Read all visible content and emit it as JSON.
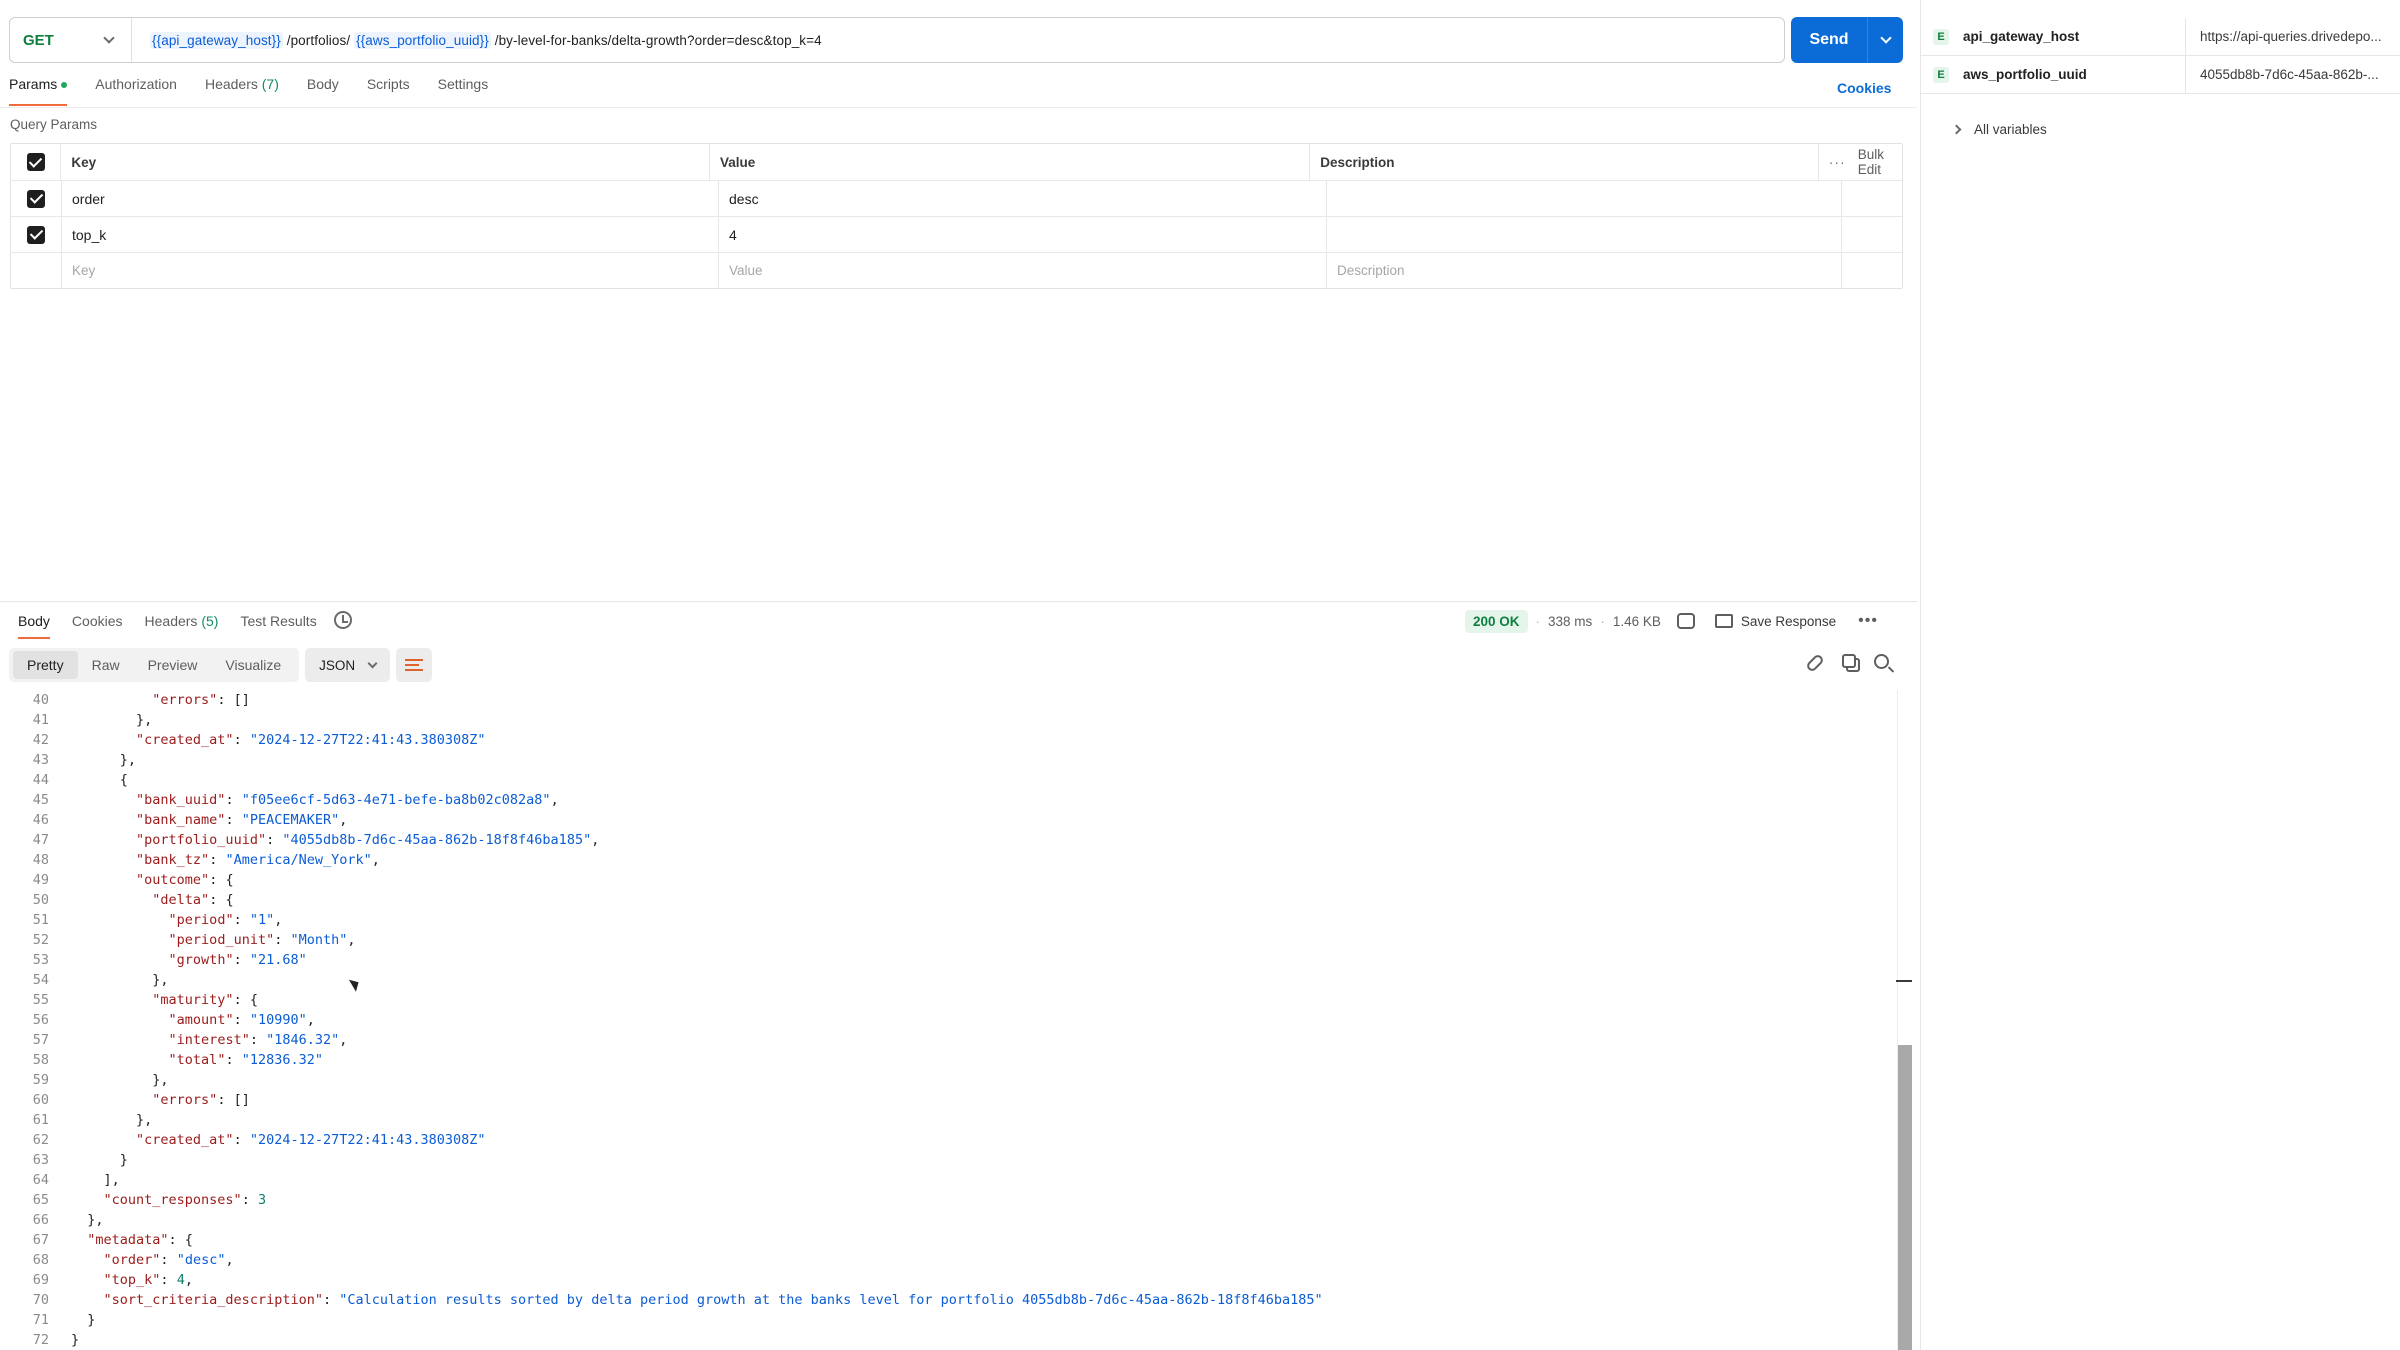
{
  "request": {
    "method": "GET",
    "url_parts": [
      {
        "text": "{{api_gateway_host}}",
        "var": true
      },
      {
        "text": " /portfolios/ ",
        "var": false
      },
      {
        "text": "{{aws_portfolio_uuid}}",
        "var": true
      },
      {
        "text": " /by-level-for-banks/delta-growth?order=desc&top_k=4",
        "var": false
      }
    ],
    "send_label": "Send",
    "tabs": [
      {
        "label": "Params",
        "dot": true,
        "active": true
      },
      {
        "label": "Authorization"
      },
      {
        "label": "Headers",
        "count": "(7)"
      },
      {
        "label": "Body"
      },
      {
        "label": "Scripts"
      },
      {
        "label": "Settings"
      }
    ],
    "cookies_label": "Cookies",
    "query_params_title": "Query Params",
    "table": {
      "headers": {
        "key": "Key",
        "value": "Value",
        "description": "Description",
        "bulk_edit": "Bulk Edit"
      },
      "rows": [
        {
          "key": "order",
          "value": "desc",
          "description": ""
        },
        {
          "key": "top_k",
          "value": "4",
          "description": ""
        }
      ],
      "placeholders": {
        "key": "Key",
        "value": "Value",
        "description": "Description"
      }
    }
  },
  "response": {
    "tabs": [
      {
        "label": "Body",
        "active": true
      },
      {
        "label": "Cookies"
      },
      {
        "label": "Headers",
        "count": "(5)"
      },
      {
        "label": "Test Results"
      }
    ],
    "status": "200 OK",
    "time": "338 ms",
    "size": "1.46 KB",
    "save_label": "Save Response",
    "modes": [
      "Pretty",
      "Raw",
      "Preview",
      "Visualize"
    ],
    "active_mode": "Pretty",
    "format": "JSON",
    "lines": [
      {
        "n": "40",
        "indent": 10,
        "tokens": [
          [
            "k",
            "\"errors\""
          ],
          [
            "p",
            ": []"
          ]
        ]
      },
      {
        "n": "41",
        "indent": 8,
        "tokens": [
          [
            "p",
            "},"
          ]
        ]
      },
      {
        "n": "42",
        "indent": 8,
        "tokens": [
          [
            "k",
            "\"created_at\""
          ],
          [
            "p",
            ": "
          ],
          [
            "s",
            "\"2024-12-27T22:41:43.380308Z\""
          ]
        ]
      },
      {
        "n": "43",
        "indent": 6,
        "tokens": [
          [
            "p",
            "},"
          ]
        ]
      },
      {
        "n": "44",
        "indent": 6,
        "tokens": [
          [
            "p",
            "{"
          ]
        ]
      },
      {
        "n": "45",
        "indent": 8,
        "tokens": [
          [
            "k",
            "\"bank_uuid\""
          ],
          [
            "p",
            ": "
          ],
          [
            "s",
            "\"f05ee6cf-5d63-4e71-befe-ba8b02c082a8\""
          ],
          [
            "p",
            ","
          ]
        ]
      },
      {
        "n": "46",
        "indent": 8,
        "tokens": [
          [
            "k",
            "\"bank_name\""
          ],
          [
            "p",
            ": "
          ],
          [
            "s",
            "\"PEACEMAKER\""
          ],
          [
            "p",
            ","
          ]
        ]
      },
      {
        "n": "47",
        "indent": 8,
        "tokens": [
          [
            "k",
            "\"portfolio_uuid\""
          ],
          [
            "p",
            ": "
          ],
          [
            "s",
            "\"4055db8b-7d6c-45aa-862b-18f8f46ba185\""
          ],
          [
            "p",
            ","
          ]
        ]
      },
      {
        "n": "48",
        "indent": 8,
        "tokens": [
          [
            "k",
            "\"bank_tz\""
          ],
          [
            "p",
            ": "
          ],
          [
            "s",
            "\"America/New_York\""
          ],
          [
            "p",
            ","
          ]
        ]
      },
      {
        "n": "49",
        "indent": 8,
        "tokens": [
          [
            "k",
            "\"outcome\""
          ],
          [
            "p",
            ": {"
          ]
        ]
      },
      {
        "n": "50",
        "indent": 10,
        "tokens": [
          [
            "k",
            "\"delta\""
          ],
          [
            "p",
            ": {"
          ]
        ]
      },
      {
        "n": "51",
        "indent": 12,
        "tokens": [
          [
            "k",
            "\"period\""
          ],
          [
            "p",
            ": "
          ],
          [
            "s",
            "\"1\""
          ],
          [
            "p",
            ","
          ]
        ]
      },
      {
        "n": "52",
        "indent": 12,
        "tokens": [
          [
            "k",
            "\"period_unit\""
          ],
          [
            "p",
            ": "
          ],
          [
            "s",
            "\"Month\""
          ],
          [
            "p",
            ","
          ]
        ]
      },
      {
        "n": "53",
        "indent": 12,
        "tokens": [
          [
            "k",
            "\"growth\""
          ],
          [
            "p",
            ": "
          ],
          [
            "s",
            "\"21.68\""
          ]
        ]
      },
      {
        "n": "54",
        "indent": 10,
        "tokens": [
          [
            "p",
            "},"
          ]
        ]
      },
      {
        "n": "55",
        "indent": 10,
        "tokens": [
          [
            "k",
            "\"maturity\""
          ],
          [
            "p",
            ": {"
          ]
        ]
      },
      {
        "n": "56",
        "indent": 12,
        "tokens": [
          [
            "k",
            "\"amount\""
          ],
          [
            "p",
            ": "
          ],
          [
            "s",
            "\"10990\""
          ],
          [
            "p",
            ","
          ]
        ]
      },
      {
        "n": "57",
        "indent": 12,
        "tokens": [
          [
            "k",
            "\"interest\""
          ],
          [
            "p",
            ": "
          ],
          [
            "s",
            "\"1846.32\""
          ],
          [
            "p",
            ","
          ]
        ]
      },
      {
        "n": "58",
        "indent": 12,
        "tokens": [
          [
            "k",
            "\"total\""
          ],
          [
            "p",
            ": "
          ],
          [
            "s",
            "\"12836.32\""
          ]
        ]
      },
      {
        "n": "59",
        "indent": 10,
        "tokens": [
          [
            "p",
            "},"
          ]
        ]
      },
      {
        "n": "60",
        "indent": 10,
        "tokens": [
          [
            "k",
            "\"errors\""
          ],
          [
            "p",
            ": []"
          ]
        ]
      },
      {
        "n": "61",
        "indent": 8,
        "tokens": [
          [
            "p",
            "},"
          ]
        ]
      },
      {
        "n": "62",
        "indent": 8,
        "tokens": [
          [
            "k",
            "\"created_at\""
          ],
          [
            "p",
            ": "
          ],
          [
            "s",
            "\"2024-12-27T22:41:43.380308Z\""
          ]
        ]
      },
      {
        "n": "63",
        "indent": 6,
        "tokens": [
          [
            "p",
            "}"
          ]
        ]
      },
      {
        "n": "64",
        "indent": 4,
        "tokens": [
          [
            "p",
            "],"
          ]
        ]
      },
      {
        "n": "65",
        "indent": 4,
        "tokens": [
          [
            "k",
            "\"count_responses\""
          ],
          [
            "p",
            ": "
          ],
          [
            "n",
            "3"
          ]
        ]
      },
      {
        "n": "66",
        "indent": 2,
        "tokens": [
          [
            "p",
            "},"
          ]
        ]
      },
      {
        "n": "67",
        "indent": 2,
        "tokens": [
          [
            "k",
            "\"metadata\""
          ],
          [
            "p",
            ": {"
          ]
        ]
      },
      {
        "n": "68",
        "indent": 4,
        "tokens": [
          [
            "k",
            "\"order\""
          ],
          [
            "p",
            ": "
          ],
          [
            "s",
            "\"desc\""
          ],
          [
            "p",
            ","
          ]
        ]
      },
      {
        "n": "69",
        "indent": 4,
        "tokens": [
          [
            "k",
            "\"top_k\""
          ],
          [
            "p",
            ": "
          ],
          [
            "n",
            "4"
          ],
          [
            "p",
            ","
          ]
        ]
      },
      {
        "n": "70",
        "indent": 4,
        "tokens": [
          [
            "k",
            "\"sort_criteria_description\""
          ],
          [
            "p",
            ": "
          ],
          [
            "s",
            "\"Calculation results sorted by delta period growth at the banks level for portfolio 4055db8b-7d6c-45aa-862b-18f8f46ba185\""
          ]
        ]
      },
      {
        "n": "71",
        "indent": 2,
        "tokens": [
          [
            "p",
            "}"
          ]
        ]
      },
      {
        "n": "72",
        "indent": 0,
        "tokens": [
          [
            "p",
            "}"
          ]
        ]
      }
    ]
  },
  "variables": {
    "items": [
      {
        "badge": "E",
        "name": "api_gateway_host",
        "value": "https://api-queries.drivedepo..."
      },
      {
        "badge": "E",
        "name": "aws_portfolio_uuid",
        "value": "4055db8b-7d6c-45aa-862b-..."
      }
    ],
    "all_label": "All variables"
  }
}
